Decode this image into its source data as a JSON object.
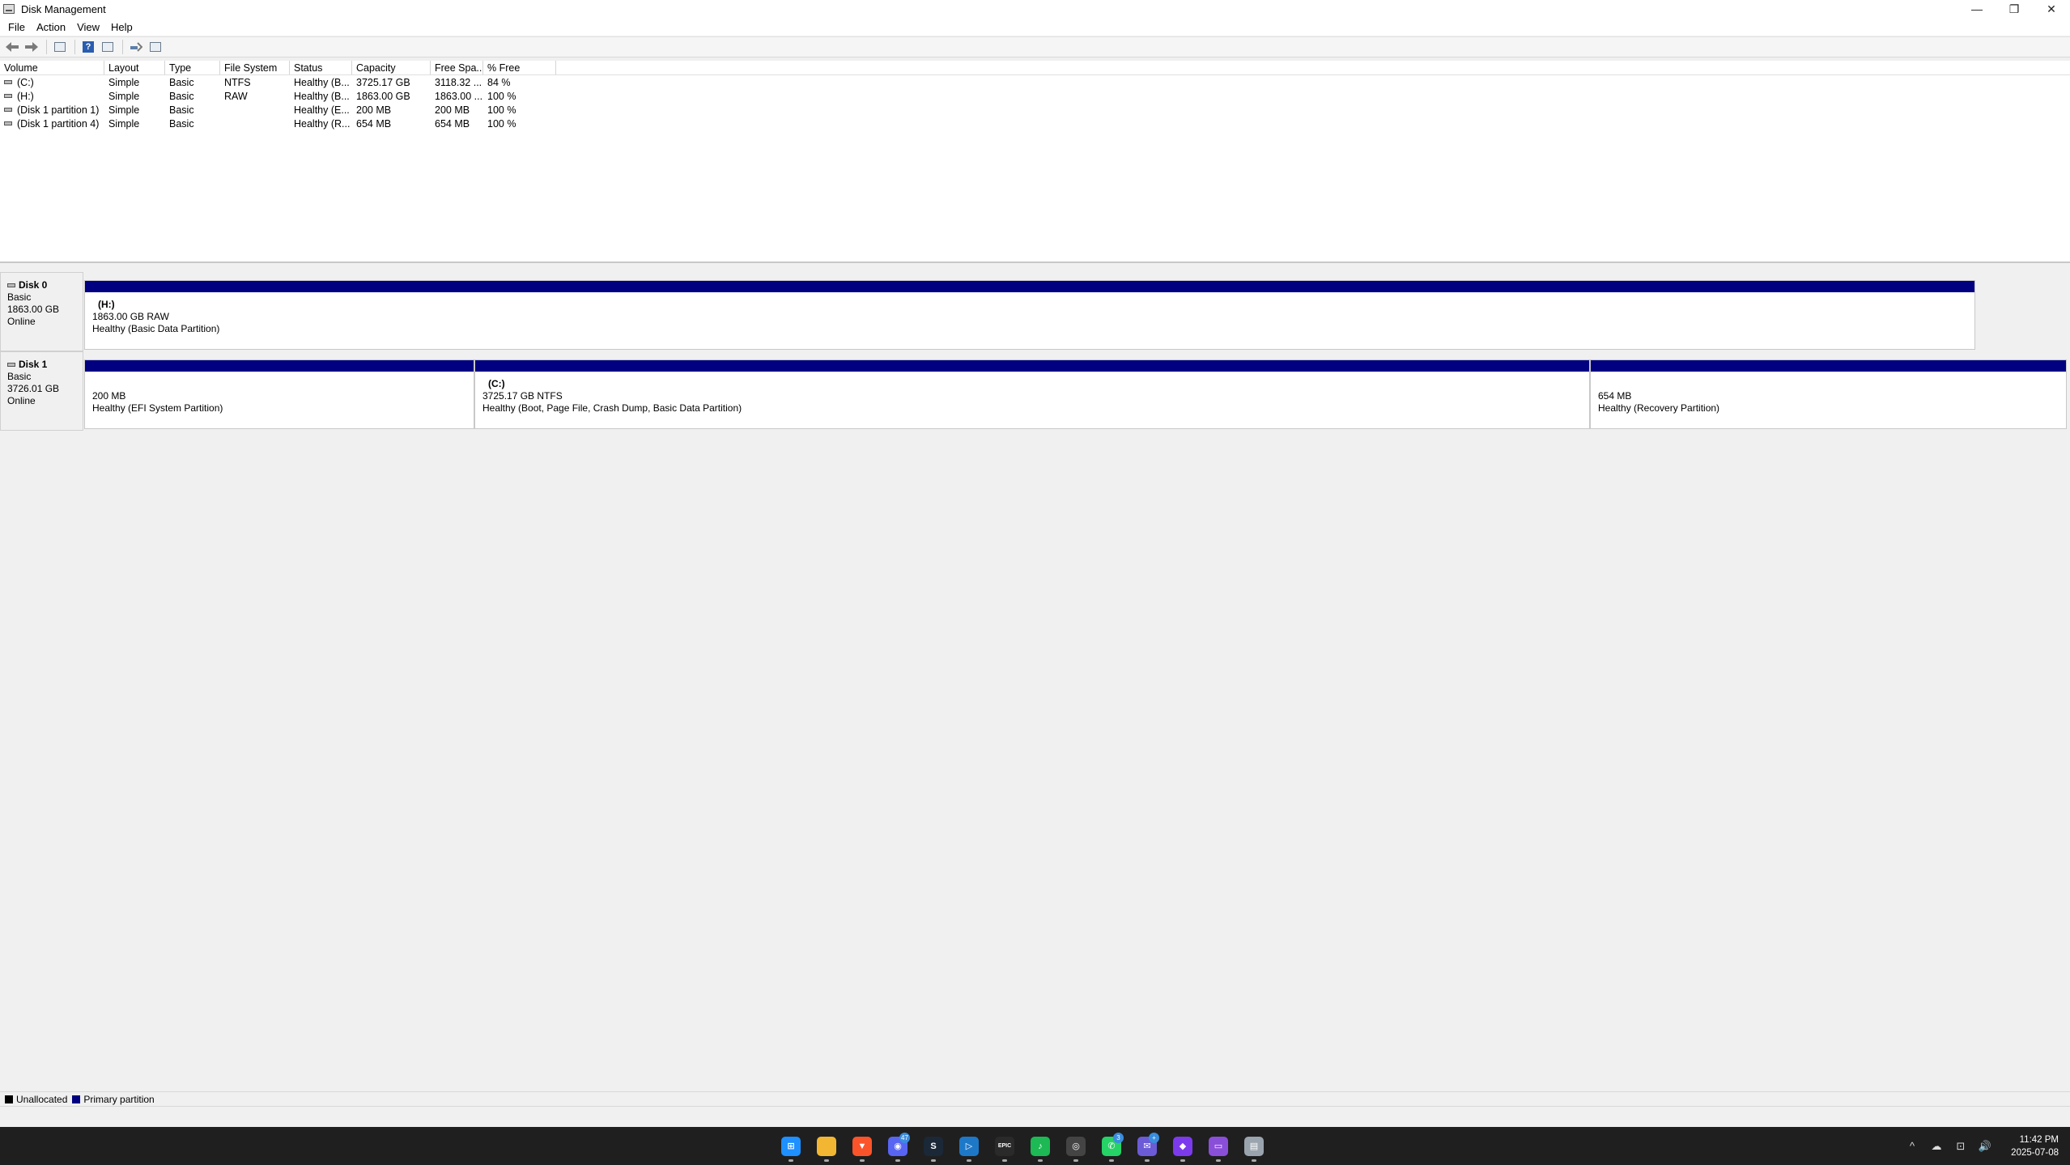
{
  "window": {
    "title": "Disk Management",
    "controls": {
      "minimize": "—",
      "restore": "❐",
      "close": "✕"
    }
  },
  "menu": [
    "File",
    "Action",
    "View",
    "Help"
  ],
  "toolbar": {
    "icons": [
      "back-arrow-icon",
      "forward-arrow-icon",
      "show-hide-console-tree-icon",
      "help-icon",
      "properties-icon",
      "connect-icon",
      "view-icon"
    ]
  },
  "volume_list": {
    "columns": [
      "Volume",
      "Layout",
      "Type",
      "File System",
      "Status",
      "Capacity",
      "Free Spa...",
      "% Free"
    ],
    "rows": [
      [
        "(C:)",
        "Simple",
        "Basic",
        "NTFS",
        "Healthy (B...",
        "3725.17 GB",
        "3118.32 ...",
        "84 %"
      ],
      [
        "(H:)",
        "Simple",
        "Basic",
        "RAW",
        "Healthy (B...",
        "1863.00 GB",
        "1863.00 ...",
        "100 %"
      ],
      [
        "(Disk 1 partition 1)",
        "Simple",
        "Basic",
        "",
        "Healthy (E...",
        "200 MB",
        "200 MB",
        "100 %"
      ],
      [
        "(Disk 1 partition 4)",
        "Simple",
        "Basic",
        "",
        "Healthy (R...",
        "654 MB",
        "654 MB",
        "100 %"
      ]
    ]
  },
  "disks": [
    {
      "name": "Disk 0",
      "type": "Basic",
      "size": "1863.00 GB",
      "state": "Online",
      "partitions": [
        {
          "name": "(H:)",
          "size": "1863.00 GB RAW",
          "status": "Healthy (Basic Data Partition)"
        }
      ]
    },
    {
      "name": "Disk 1",
      "type": "Basic",
      "size": "3726.01 GB",
      "state": "Online",
      "partitions": [
        {
          "name": "",
          "size": "200 MB",
          "status": "Healthy (EFI System Partition)"
        },
        {
          "name": "(C:)",
          "size": "3725.17 GB NTFS",
          "status": "Healthy (Boot, Page File, Crash Dump, Basic Data Partition)"
        },
        {
          "name": "",
          "size": "654 MB",
          "status": "Healthy (Recovery Partition)"
        }
      ]
    }
  ],
  "legend": [
    {
      "label": "Unallocated",
      "color": "#000000"
    },
    {
      "label": "Primary partition",
      "color": "#000080"
    }
  ],
  "taskbar": {
    "apps": [
      {
        "name": "start",
        "color": "#1e90ff",
        "glyph": "⊞"
      },
      {
        "name": "file-explorer",
        "color": "#f2b632",
        "glyph": ""
      },
      {
        "name": "brave",
        "color": "#fb542b",
        "glyph": "▼"
      },
      {
        "name": "discord",
        "color": "#5865f2",
        "glyph": "◉",
        "badge": "47"
      },
      {
        "name": "steam",
        "color": "#1b2838",
        "glyph": "S"
      },
      {
        "name": "remote",
        "color": "#1e78c8",
        "glyph": "▷"
      },
      {
        "name": "epic-games",
        "color": "#2a2a2a",
        "glyph": "EPIC"
      },
      {
        "name": "spotify",
        "color": "#1db954",
        "glyph": "♪"
      },
      {
        "name": "app",
        "color": "#444444",
        "glyph": "◎"
      },
      {
        "name": "whatsapp",
        "color": "#25d366",
        "glyph": "✆",
        "badge": "3"
      },
      {
        "name": "mail",
        "color": "#6b5bd6",
        "glyph": "✉",
        "badge": "+"
      },
      {
        "name": "obsidian",
        "color": "#7c3aed",
        "glyph": "◆"
      },
      {
        "name": "files",
        "color": "#8a4fd8",
        "glyph": "▭"
      },
      {
        "name": "disk-management",
        "color": "#9aa4ae",
        "glyph": "▤"
      }
    ],
    "tray": [
      "^",
      "☁",
      "⊡",
      "🔊"
    ],
    "time": "11:42 PM",
    "date": "2025-07-08"
  }
}
